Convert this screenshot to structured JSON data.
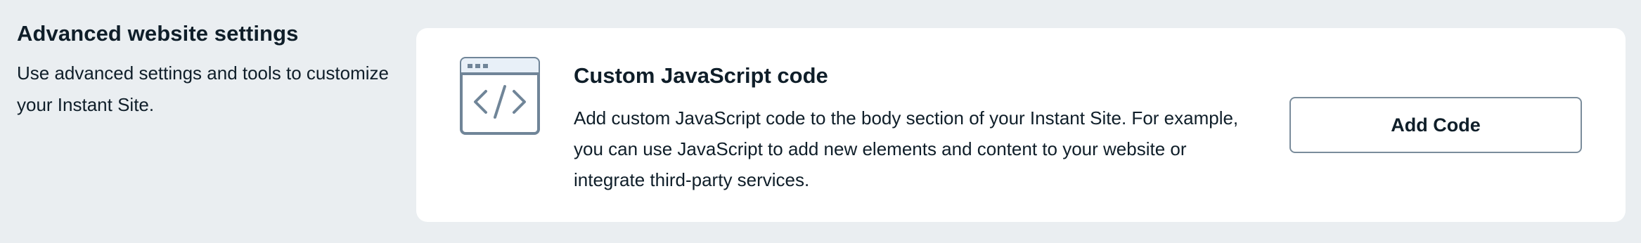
{
  "section": {
    "title": "Advanced website settings",
    "description": "Use advanced settings and tools to customize your Instant Site."
  },
  "card": {
    "icon": "code-window-icon",
    "title": "Custom JavaScript code",
    "description": "Add custom JavaScript code to the body section of your Instant Site. For example, you can use JavaScript to add new elements and content to your website or integrate third-party services.",
    "button_label": "Add Code"
  },
  "colors": {
    "page_background": "#eaeef1",
    "card_background": "#ffffff",
    "text": "#0f1e29",
    "icon_stroke": "#708598",
    "button_border": "#7a8c9b"
  }
}
